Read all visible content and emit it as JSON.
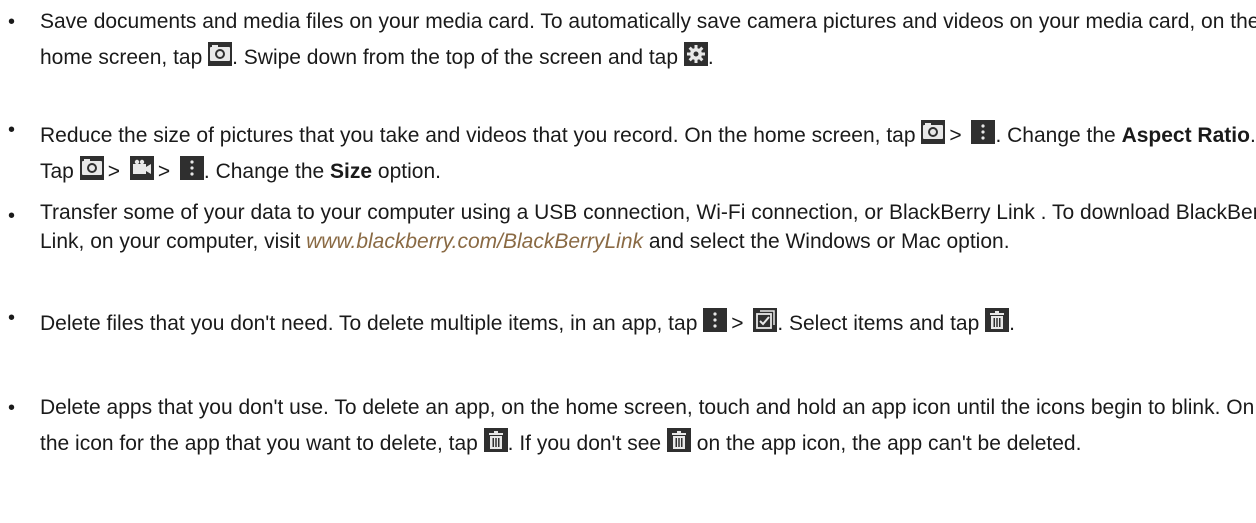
{
  "items": [
    {
      "t1": "Save documents and media files on your media card. To automatically save camera pictures and videos on your media card, on the home screen, tap",
      "t2": ". Swipe down from the top of the screen and tap",
      "t3": "."
    },
    {
      "t1": "Reduce the size of pictures that you take and videos that you record. On the home screen, tap",
      "gt1": ">",
      "t2": ". Change the",
      "b1": "Aspect Ratio",
      "t3": ". Tap",
      "gt2": ">",
      "gt3": ">",
      "t4": ". Change the",
      "b2": "Size",
      "t5": "option."
    },
    {
      "t1": "Transfer some of your data to your computer using a USB connection, Wi-Fi connection, or BlackBerry Link . To download BlackBerry Link, on your computer, visit",
      "link": "www.blackberry.com/BlackBerryLink",
      "t2": "and select the Windows or Mac option."
    },
    {
      "t1": "Delete files that you don't need. To delete multiple items, in an app, tap",
      "gt1": ">",
      "t2": ". Select items and tap",
      "t3": "."
    },
    {
      "t1": "Delete apps that you don't use. To delete an app, on the home screen, touch and hold an app icon until the icons begin to blink. On the icon for the app that you want to delete, tap",
      "t2": ". If you don't see",
      "t3": "on the app icon, the app can't be deleted."
    }
  ],
  "bullet_char": "•",
  "colors": {
    "text": "#1a1a1a",
    "link": "#8a6a44",
    "icon_bg": "#2f2f2f"
  },
  "icons": [
    "camera-icon",
    "settings-gear-icon",
    "overflow-menu-icon",
    "video-camera-icon",
    "multi-select-icon",
    "trash-icon"
  ]
}
